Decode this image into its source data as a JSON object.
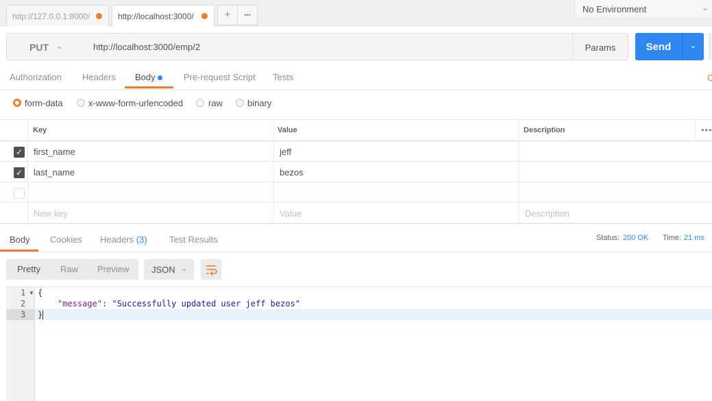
{
  "tabs": [
    {
      "label": "http://127.0.0.1:8000/"
    },
    {
      "label": "http://localhost:3000/"
    }
  ],
  "tab_buttons": {
    "add": "+",
    "more": "•••"
  },
  "environment": {
    "label": "No Environment"
  },
  "request": {
    "method": "PUT",
    "url": "http://localhost:3000/emp/2",
    "params_label": "Params",
    "send_label": "Send"
  },
  "request_tabs": [
    "Authorization",
    "Headers",
    "Body",
    "Pre-request Script",
    "Tests"
  ],
  "body_types": [
    "form-data",
    "x-www-form-urlencoded",
    "raw",
    "binary"
  ],
  "table": {
    "headers": [
      "Key",
      "Value",
      "Description"
    ],
    "rows": [
      {
        "checked": true,
        "key": "first_name",
        "value": "jeff",
        "description": ""
      },
      {
        "checked": true,
        "key": "last_name",
        "value": "bezos",
        "description": ""
      }
    ],
    "placeholders": {
      "key": "New key",
      "value": "Value",
      "description": "Description"
    }
  },
  "response_tabs": {
    "body": "Body",
    "cookies": "Cookies",
    "headers": "Headers",
    "headers_count": "(3)",
    "test_results": "Test Results"
  },
  "status": {
    "status_label": "Status:",
    "status_value": "200 OK",
    "time_label": "Time:",
    "time_value": "21 ms"
  },
  "view_modes": [
    "Pretty",
    "Raw",
    "Preview"
  ],
  "format": "JSON",
  "code": {
    "line_numbers": [
      "1",
      "2",
      "3"
    ],
    "line1": "{",
    "key": "\"message\"",
    "colon": ": ",
    "value": "\"Successfully updated user jeff bezos\"",
    "line3": "}"
  },
  "colors": {
    "accent": "#f07d2a",
    "primary": "#2f86f0"
  }
}
